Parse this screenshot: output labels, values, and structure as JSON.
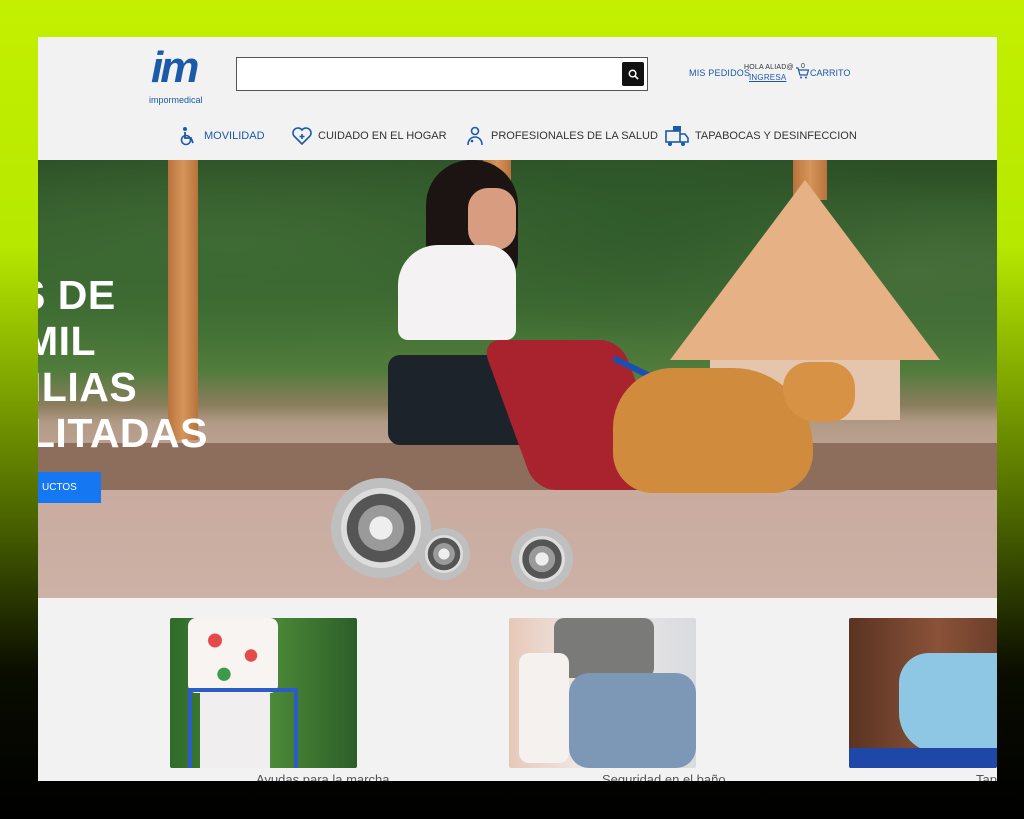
{
  "brand": {
    "logo_mark": "im",
    "logo_text": "impormedical"
  },
  "search": {
    "placeholder": ""
  },
  "header_links": {
    "mis_pedidos": "MIS PEDIDOS",
    "hola": "HOLA ALIAD@",
    "ingresa": "INGRESA",
    "cart_count": "0",
    "carrito": "CARRITO"
  },
  "nav": {
    "items": [
      {
        "label": "MOVILIDAD",
        "icon": "wheelchair-icon"
      },
      {
        "label": "CUIDADO EN EL HOGAR",
        "icon": "heart-plus-icon"
      },
      {
        "label": "PROFESIONALES DE LA SALUD",
        "icon": "doctor-icon"
      },
      {
        "label": "TAPABOCAS Y DESINFECCION",
        "icon": "mask-truck-icon"
      }
    ]
  },
  "hero": {
    "title_lines": [
      "S DE",
      "MIL",
      "IILIAS",
      "ILITADAS"
    ],
    "button_label": "UCTOS"
  },
  "products": [
    {
      "label": "Ayudas para la marcha"
    },
    {
      "label": "Seguridad en el baño"
    },
    {
      "label": "Tap"
    }
  ],
  "colors": {
    "brand_blue": "#1a5aa8",
    "cta_blue": "#1677f2",
    "header_bg": "#f2f2f2"
  }
}
